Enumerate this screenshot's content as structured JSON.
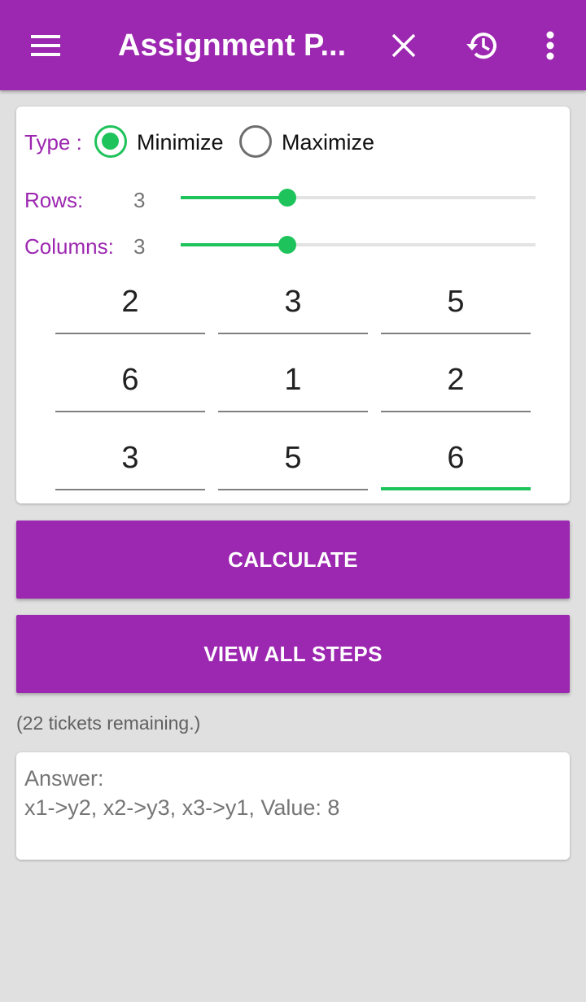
{
  "app_bar": {
    "title": "Assignment P...",
    "icons": [
      "menu-icon",
      "close-icon",
      "history-icon",
      "more-vert-icon"
    ]
  },
  "type": {
    "label": "Type :",
    "options": [
      "Minimize",
      "Maximize"
    ],
    "selected": "Minimize"
  },
  "rows": {
    "label": "Rows:",
    "value": "3",
    "slider_fraction": 0.3
  },
  "columns": {
    "label": "Columns:",
    "value": "3",
    "slider_fraction": 0.3
  },
  "matrix": [
    [
      "2",
      "3",
      "5"
    ],
    [
      "6",
      "1",
      "2"
    ],
    [
      "3",
      "5",
      "6"
    ]
  ],
  "focused_cell": [
    2,
    2
  ],
  "buttons": {
    "calculate": "CALCULATE",
    "view_all_steps": "VIEW ALL STEPS"
  },
  "tickets": "(22 tickets remaining.)",
  "answer": {
    "heading": "Answer:",
    "text": "x1->y2, x2->y3, x3->y1, Value: 8"
  },
  "colors": {
    "primary": "#9c27b0",
    "accent": "#1ec35b",
    "background": "#e0e0e0"
  }
}
